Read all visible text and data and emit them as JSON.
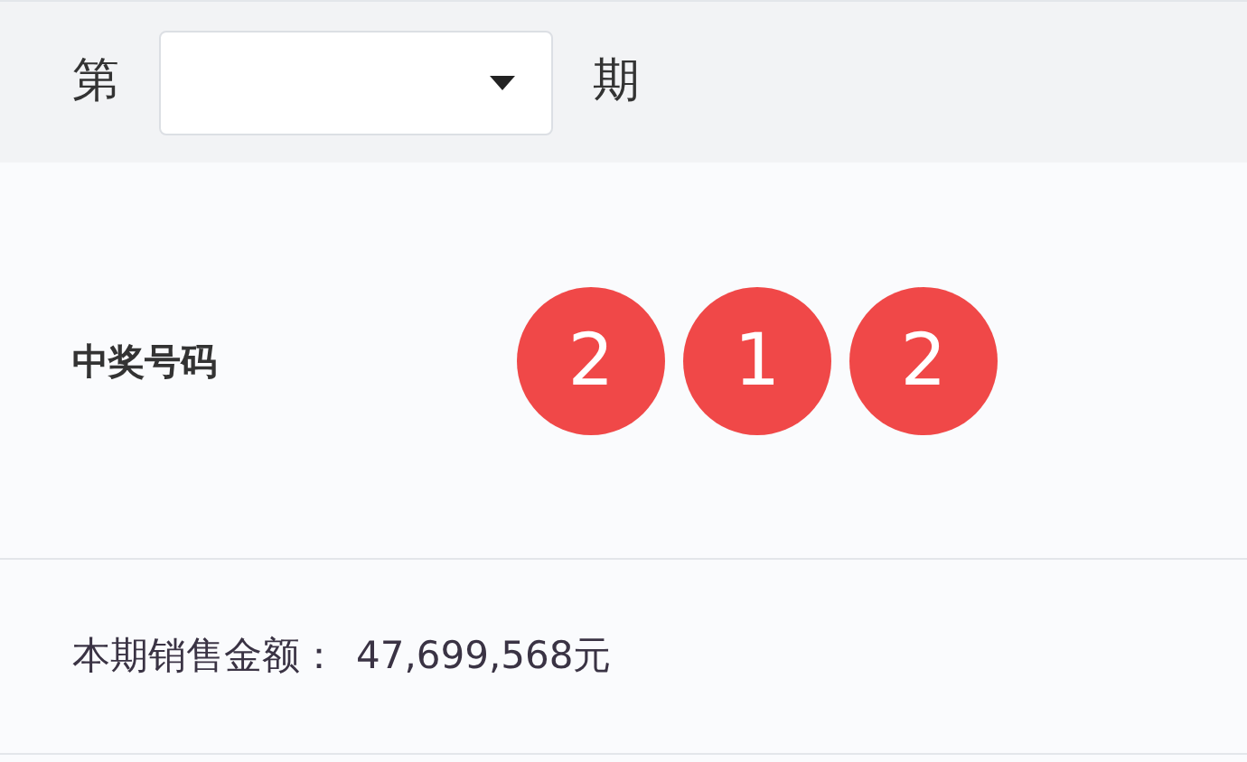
{
  "period_selector": {
    "prefix": "第",
    "suffix": "期"
  },
  "winning_numbers": {
    "label": "中奖号码",
    "balls": [
      "2",
      "1",
      "2"
    ]
  },
  "sales": {
    "label": "本期销售金额：",
    "amount": "47,699,568元"
  }
}
